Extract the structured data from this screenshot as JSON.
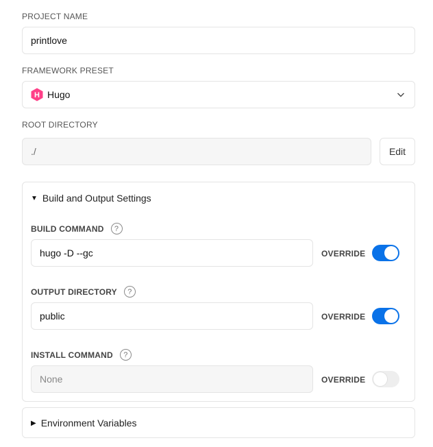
{
  "project_name": {
    "label": "PROJECT NAME",
    "value": "printlove"
  },
  "framework_preset": {
    "label": "FRAMEWORK PRESET",
    "value": "Hugo",
    "icon": "hugo-logo-icon",
    "logo_letter": "H",
    "logo_color": "#ff4088"
  },
  "root_directory": {
    "label": "ROOT DIRECTORY",
    "value": "./",
    "edit_label": "Edit"
  },
  "build_output": {
    "title": "Build and Output Settings",
    "expanded": true,
    "build_command": {
      "label": "BUILD COMMAND",
      "value": "hugo -D --gc",
      "override_label": "OVERRIDE",
      "override_on": true
    },
    "output_directory": {
      "label": "OUTPUT DIRECTORY",
      "value": "public",
      "override_label": "OVERRIDE",
      "override_on": true
    },
    "install_command": {
      "label": "INSTALL COMMAND",
      "placeholder": "None",
      "override_label": "OVERRIDE",
      "override_on": false
    },
    "help_glyph": "?"
  },
  "environment_variables": {
    "title": "Environment Variables",
    "expanded": false
  },
  "colors": {
    "accent": "#0a72e8",
    "border": "#e4e4e4",
    "disabled_bg": "#f6f6f6"
  }
}
